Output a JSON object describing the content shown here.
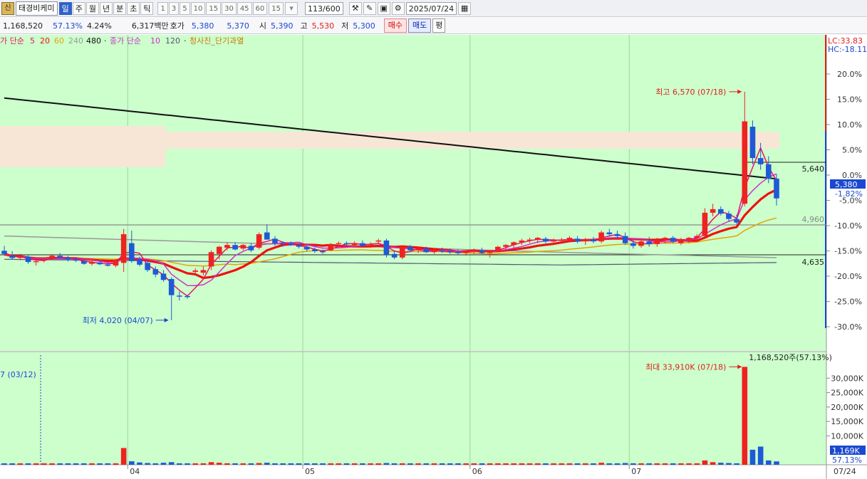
{
  "toolbar": {
    "shin": "신",
    "stock_name": "태경비케미",
    "period_tabs": [
      "일",
      "주",
      "월",
      "년",
      "분",
      "초",
      "틱"
    ],
    "active_tab": "일",
    "minute_options": [
      "1",
      "3",
      "5",
      "10",
      "15",
      "30",
      "45",
      "60"
    ],
    "minute_selected": "15",
    "count": "113/600",
    "date": "2025/07/24"
  },
  "info": {
    "volume": "1,168,520",
    "volume_ratio": "57.13%",
    "turnover": "4.24%",
    "amount": "6,317백만",
    "quote_label": "호가",
    "ask": "5,380",
    "bid": "5,370",
    "open_label": "시",
    "open": "5,390",
    "high_label": "고",
    "high": "5,530",
    "low_label": "저",
    "low": "5,300",
    "buy_button": "매수",
    "sell_button": "매도",
    "avg_button": "평"
  },
  "legend": {
    "price_ma_label": "가 단순",
    "price_ma_5": "5",
    "price_ma_20": "20",
    "price_ma_60": "60",
    "price_ma_240": "240",
    "price_ma_480": "480",
    "close_ma_label": "종가 단순",
    "close_ma_10": "10",
    "close_ma_120": "120",
    "overlay": "청사진_단기과열"
  },
  "colors": {
    "background": "#ccffcc",
    "up": "#ee2222",
    "down": "#1e5ad6",
    "ma5": "#ee1166",
    "ma20": "#ee1111",
    "ma60": "#e8a200",
    "ma240": "#999999",
    "ma480": "#111111",
    "ma10": "#cc33cc",
    "ma120": "#555577",
    "zone": "#f7e6d6"
  },
  "chart_data": {
    "type": "candlestick",
    "price_axis": {
      "right_labels": [
        "20.0%",
        "15.0%",
        "10.0%",
        "5.0%",
        "0.0%",
        "-5.0%",
        "-10.0%",
        "-15.0%",
        "-20.0%",
        "-25.0%",
        "-30.0%"
      ],
      "reference_price": 5640,
      "lc": "LC:33.83",
      "hc": "HC:-18.11",
      "current_price": "5,380",
      "current_change": "-1.82%",
      "level_labels": [
        "5,640",
        "4,960",
        "4,635"
      ]
    },
    "annotations": {
      "high": "최고 6,570 (07/18)",
      "low": "최저 4,020 (04/07)",
      "volume_max": "최대 33,910K (07/18)",
      "volume_left": "7 (03/12)",
      "volume_current": "1,168,520주(57.13%)"
    },
    "x_labels": [
      "04",
      "05",
      "06",
      "07"
    ],
    "x_label_current": "07/24",
    "volume_axis": {
      "labels": [
        "30,000K",
        "25,000K",
        "20,000K",
        "15,000K",
        "10,000K"
      ],
      "current_label": "1,169K",
      "current_ratio": "57.13%"
    },
    "candles": [
      {
        "o": 4795,
        "h": 4850,
        "l": 4740,
        "c": 4760
      },
      {
        "o": 4740,
        "h": 4790,
        "l": 4700,
        "c": 4715
      },
      {
        "o": 4715,
        "h": 4760,
        "l": 4690,
        "c": 4730
      },
      {
        "o": 4730,
        "h": 4745,
        "l": 4650,
        "c": 4670
      },
      {
        "o": 4670,
        "h": 4700,
        "l": 4630,
        "c": 4680
      },
      {
        "o": 4690,
        "h": 4720,
        "l": 4665,
        "c": 4705
      },
      {
        "o": 4705,
        "h": 4760,
        "l": 4690,
        "c": 4740
      },
      {
        "o": 4740,
        "h": 4770,
        "l": 4705,
        "c": 4720
      },
      {
        "o": 4720,
        "h": 4740,
        "l": 4675,
        "c": 4700
      },
      {
        "o": 4700,
        "h": 4720,
        "l": 4670,
        "c": 4685
      },
      {
        "o": 4680,
        "h": 4700,
        "l": 4640,
        "c": 4650
      },
      {
        "o": 4650,
        "h": 4680,
        "l": 4630,
        "c": 4670
      },
      {
        "o": 4665,
        "h": 4690,
        "l": 4635,
        "c": 4645
      },
      {
        "o": 4640,
        "h": 4665,
        "l": 4620,
        "c": 4630
      },
      {
        "o": 4630,
        "h": 4700,
        "l": 4610,
        "c": 4690
      },
      {
        "o": 4660,
        "h": 5040,
        "l": 4560,
        "c": 4980
      },
      {
        "o": 4880,
        "h": 5020,
        "l": 4660,
        "c": 4680
      },
      {
        "o": 4700,
        "h": 4730,
        "l": 4620,
        "c": 4640
      },
      {
        "o": 4660,
        "h": 4690,
        "l": 4560,
        "c": 4580
      },
      {
        "o": 4590,
        "h": 4620,
        "l": 4500,
        "c": 4530
      },
      {
        "o": 4540,
        "h": 4580,
        "l": 4450,
        "c": 4470
      },
      {
        "o": 4480,
        "h": 4500,
        "l": 4020,
        "c": 4300
      },
      {
        "o": 4295,
        "h": 4340,
        "l": 4240,
        "c": 4290
      },
      {
        "o": 4290,
        "h": 4300,
        "l": 4260,
        "c": 4280
      },
      {
        "o": 4560,
        "h": 4600,
        "l": 4520,
        "c": 4575
      },
      {
        "o": 4550,
        "h": 4620,
        "l": 4520,
        "c": 4580
      },
      {
        "o": 4620,
        "h": 4800,
        "l": 4580,
        "c": 4780
      },
      {
        "o": 4760,
        "h": 4850,
        "l": 4700,
        "c": 4840
      },
      {
        "o": 4830,
        "h": 4890,
        "l": 4800,
        "c": 4860
      },
      {
        "o": 4860,
        "h": 4890,
        "l": 4800,
        "c": 4810
      },
      {
        "o": 4820,
        "h": 4870,
        "l": 4800,
        "c": 4860
      },
      {
        "o": 4850,
        "h": 4880,
        "l": 4780,
        "c": 4800
      },
      {
        "o": 4830,
        "h": 5000,
        "l": 4810,
        "c": 4980
      },
      {
        "o": 5000,
        "h": 5090,
        "l": 4920,
        "c": 4920
      },
      {
        "o": 4930,
        "h": 4960,
        "l": 4850,
        "c": 4880
      },
      {
        "o": 4880,
        "h": 4900,
        "l": 4840,
        "c": 4870
      },
      {
        "o": 4880,
        "h": 4900,
        "l": 4850,
        "c": 4860
      },
      {
        "o": 4860,
        "h": 4880,
        "l": 4820,
        "c": 4840
      },
      {
        "o": 4840,
        "h": 4860,
        "l": 4790,
        "c": 4810
      },
      {
        "o": 4810,
        "h": 4830,
        "l": 4770,
        "c": 4790
      },
      {
        "o": 4790,
        "h": 4810,
        "l": 4760,
        "c": 4780
      },
      {
        "o": 4800,
        "h": 4880,
        "l": 4790,
        "c": 4870
      },
      {
        "o": 4870,
        "h": 4900,
        "l": 4840,
        "c": 4880
      },
      {
        "o": 4880,
        "h": 4900,
        "l": 4850,
        "c": 4870
      },
      {
        "o": 4860,
        "h": 4900,
        "l": 4840,
        "c": 4880
      },
      {
        "o": 4880,
        "h": 4910,
        "l": 4840,
        "c": 4850
      },
      {
        "o": 4860,
        "h": 4890,
        "l": 4830,
        "c": 4870
      },
      {
        "o": 4900,
        "h": 4930,
        "l": 4870,
        "c": 4910
      },
      {
        "o": 4910,
        "h": 4930,
        "l": 4720,
        "c": 4750
      },
      {
        "o": 4760,
        "h": 4790,
        "l": 4700,
        "c": 4720
      },
      {
        "o": 4720,
        "h": 4850,
        "l": 4700,
        "c": 4840
      },
      {
        "o": 4840,
        "h": 4860,
        "l": 4780,
        "c": 4800
      },
      {
        "o": 4800,
        "h": 4840,
        "l": 4770,
        "c": 4820
      },
      {
        "o": 4820,
        "h": 4840,
        "l": 4770,
        "c": 4780
      },
      {
        "o": 4780,
        "h": 4820,
        "l": 4760,
        "c": 4800
      },
      {
        "o": 4800,
        "h": 4830,
        "l": 4770,
        "c": 4790
      },
      {
        "o": 4790,
        "h": 4820,
        "l": 4760,
        "c": 4780
      },
      {
        "o": 4780,
        "h": 4810,
        "l": 4750,
        "c": 4770
      },
      {
        "o": 4770,
        "h": 4800,
        "l": 4740,
        "c": 4790
      },
      {
        "o": 4790,
        "h": 4820,
        "l": 4760,
        "c": 4800
      },
      {
        "o": 4800,
        "h": 4830,
        "l": 4760,
        "c": 4770
      },
      {
        "o": 4770,
        "h": 4800,
        "l": 4720,
        "c": 4790
      },
      {
        "o": 4790,
        "h": 4850,
        "l": 4780,
        "c": 4840
      },
      {
        "o": 4840,
        "h": 4870,
        "l": 4810,
        "c": 4860
      },
      {
        "o": 4860,
        "h": 4900,
        "l": 4830,
        "c": 4890
      },
      {
        "o": 4890,
        "h": 4930,
        "l": 4860,
        "c": 4910
      },
      {
        "o": 4910,
        "h": 4940,
        "l": 4880,
        "c": 4920
      },
      {
        "o": 4920,
        "h": 4950,
        "l": 4880,
        "c": 4940
      },
      {
        "o": 4930,
        "h": 4950,
        "l": 4880,
        "c": 4900
      },
      {
        "o": 4900,
        "h": 4930,
        "l": 4860,
        "c": 4910
      },
      {
        "o": 4910,
        "h": 4940,
        "l": 4880,
        "c": 4920
      },
      {
        "o": 4920,
        "h": 4960,
        "l": 4890,
        "c": 4940
      },
      {
        "o": 4930,
        "h": 4960,
        "l": 4880,
        "c": 4900
      },
      {
        "o": 4900,
        "h": 4940,
        "l": 4860,
        "c": 4920
      },
      {
        "o": 4920,
        "h": 4950,
        "l": 4880,
        "c": 4900
      },
      {
        "o": 4900,
        "h": 5020,
        "l": 4880,
        "c": 5000
      },
      {
        "o": 5000,
        "h": 5040,
        "l": 4960,
        "c": 4980
      },
      {
        "o": 4980,
        "h": 5020,
        "l": 4940,
        "c": 4960
      },
      {
        "o": 4960,
        "h": 5000,
        "l": 4860,
        "c": 4880
      },
      {
        "o": 4880,
        "h": 4920,
        "l": 4820,
        "c": 4850
      },
      {
        "o": 4850,
        "h": 4920,
        "l": 4830,
        "c": 4900
      },
      {
        "o": 4900,
        "h": 4950,
        "l": 4840,
        "c": 4870
      },
      {
        "o": 4870,
        "h": 4940,
        "l": 4840,
        "c": 4920
      },
      {
        "o": 4920,
        "h": 4950,
        "l": 4880,
        "c": 4940
      },
      {
        "o": 4940,
        "h": 4960,
        "l": 4880,
        "c": 4900
      },
      {
        "o": 4880,
        "h": 4940,
        "l": 4860,
        "c": 4920
      },
      {
        "o": 4920,
        "h": 4950,
        "l": 4880,
        "c": 4940
      },
      {
        "o": 4940,
        "h": 4980,
        "l": 4910,
        "c": 4960
      },
      {
        "o": 4960,
        "h": 5270,
        "l": 4950,
        "c": 5220
      },
      {
        "o": 5220,
        "h": 5320,
        "l": 5180,
        "c": 5260
      },
      {
        "o": 5260,
        "h": 5290,
        "l": 5190,
        "c": 5210
      },
      {
        "o": 5210,
        "h": 5240,
        "l": 5120,
        "c": 5150
      },
      {
        "o": 5150,
        "h": 5200,
        "l": 5090,
        "c": 5110
      },
      {
        "o": 5320,
        "h": 6570,
        "l": 5290,
        "c": 6240
      },
      {
        "o": 6180,
        "h": 6250,
        "l": 5760,
        "c": 5830
      },
      {
        "o": 5830,
        "h": 6000,
        "l": 5700,
        "c": 5760
      },
      {
        "o": 5760,
        "h": 5850,
        "l": 5550,
        "c": 5600
      },
      {
        "o": 5600,
        "h": 5650,
        "l": 5300,
        "c": 5380
      }
    ],
    "volume": [
      250,
      200,
      180,
      220,
      200,
      190,
      200,
      180,
      170,
      160,
      200,
      220,
      200,
      180,
      190,
      5800,
      1200,
      800,
      600,
      500,
      700,
      900,
      400,
      300,
      400,
      500,
      900,
      700,
      500,
      400,
      450,
      380,
      600,
      700,
      400,
      350,
      330,
      300,
      280,
      260,
      250,
      300,
      350,
      320,
      300,
      330,
      310,
      330,
      600,
      450,
      420,
      380,
      360,
      340,
      320,
      310,
      300,
      290,
      280,
      300,
      330,
      350,
      380,
      400,
      420,
      440,
      460,
      420,
      400,
      380,
      370,
      390,
      410,
      380,
      360,
      700,
      500,
      460,
      600,
      500,
      480,
      460,
      440,
      430,
      420,
      430,
      440,
      460,
      1500,
      900,
      700,
      600,
      500,
      33910,
      5200,
      6300,
      1500,
      1169
    ]
  }
}
